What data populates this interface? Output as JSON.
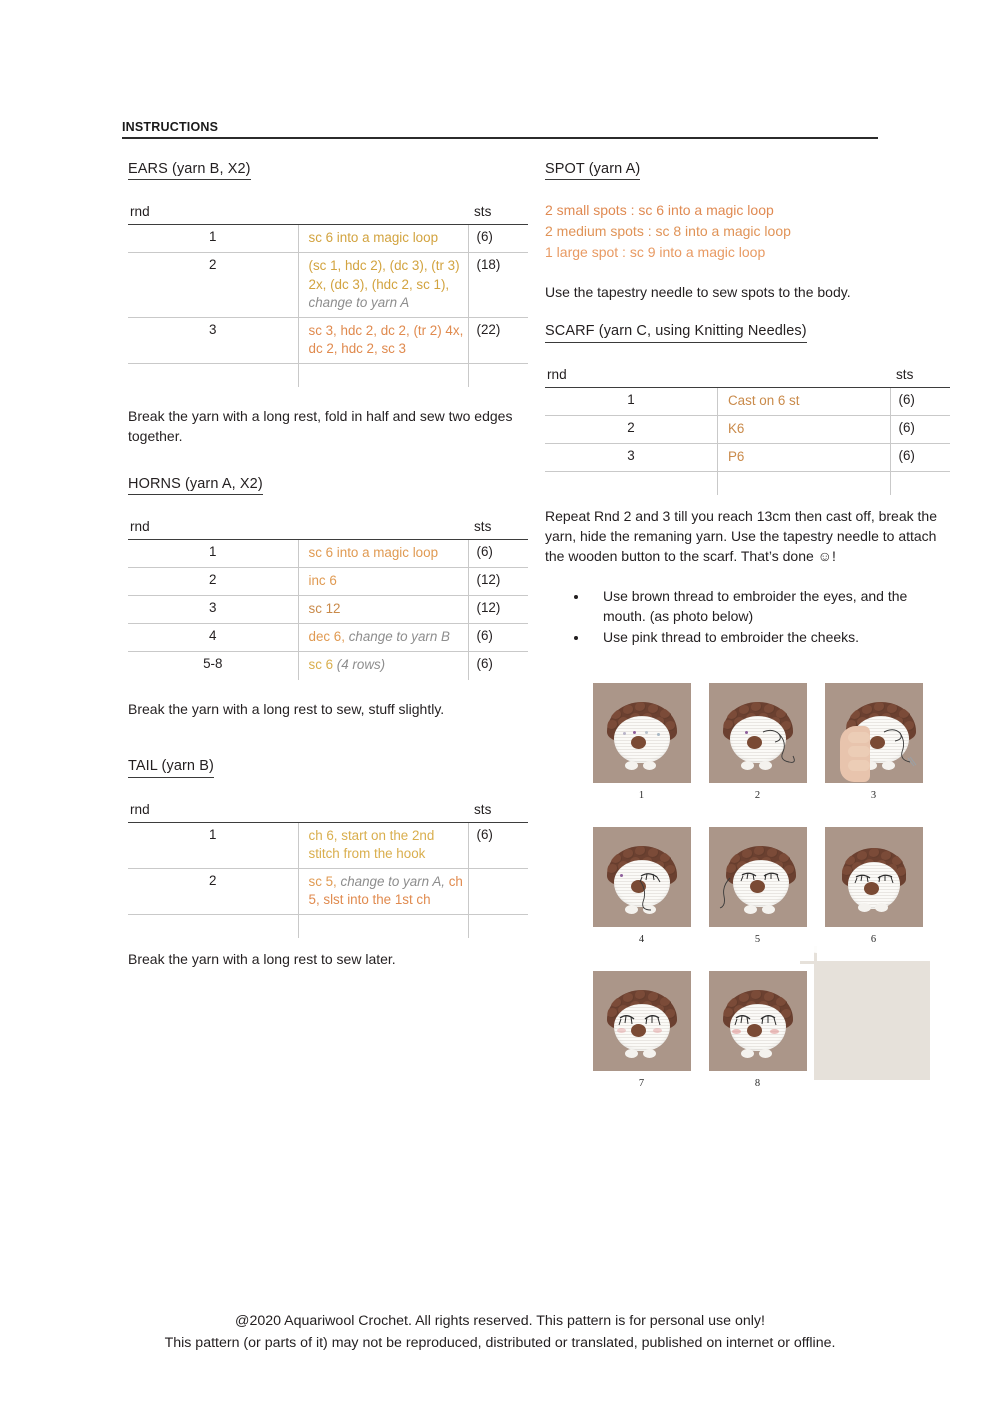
{
  "header": {
    "title": "INSTRUCTIONS"
  },
  "left_column": {
    "ears": {
      "heading": "EARS (yarn B, X2)",
      "columns": {
        "rnd": "rnd",
        "sts": "sts"
      },
      "rows": [
        {
          "rnd": "1",
          "body": "sc 6 into a magic loop",
          "sts": "(6)"
        },
        {
          "rnd": "2",
          "body": "(sc 1, hdc 2), (dc 3), (tr 3) 2x, (dc 3), (hdc 2, sc 1),",
          "note": " change to yarn A",
          "sts": "(18)"
        },
        {
          "rnd": "3",
          "body": "sc 3, hdc 2, dc 2, (tr 2) 4x, dc 2, hdc 2, sc 3",
          "sts": "(22)"
        }
      ],
      "after_text": "Break the yarn with a long rest, fold in half and sew two edges together."
    },
    "horns": {
      "heading": "HORNS (yarn A, X2)",
      "columns": {
        "rnd": "rnd",
        "sts": "sts"
      },
      "rows": [
        {
          "rnd": "1",
          "body": "sc 6 into a magic loop",
          "sts": "(6)"
        },
        {
          "rnd": "2",
          "body": "inc 6",
          "sts": "(12)"
        },
        {
          "rnd": "3",
          "body": "sc 12",
          "sts": "(12)"
        },
        {
          "rnd": "4",
          "body": "dec 6,",
          "note": " change to yarn B",
          "sts": "(6)"
        },
        {
          "rnd": "5-8",
          "body": "sc 6",
          "note": " (4 rows)",
          "sts": "(6)"
        }
      ],
      "after_text": "Break the yarn with a long rest to sew, stuff slightly."
    },
    "tail": {
      "heading": "TAIL (yarn B)",
      "columns": {
        "rnd": "rnd",
        "sts": "sts"
      },
      "rows": [
        {
          "rnd": "1",
          "body": "ch 6, start on the 2nd stitch from the hook",
          "sts": "(6)"
        },
        {
          "rnd": "2",
          "body": "sc 5,",
          "note": " change to yarn A,",
          "body2": " ch 5, slst into the 1st ch",
          "sts": ""
        }
      ],
      "after_text": "Break the yarn with a long rest to sew later."
    }
  },
  "right_column": {
    "spot": {
      "heading": "SPOT (yarn A)",
      "lines": [
        "2 small spots : sc 6 into a magic loop",
        "2 medium spots : sc 8 into a magic loop",
        "1 large spot : sc 9 into a magic loop"
      ],
      "after_text": "Use the tapestry needle to sew spots to the body."
    },
    "scarf": {
      "heading": "SCARF (yarn C, using Knitting Needles)",
      "columns": {
        "rnd": "rnd",
        "sts": "sts"
      },
      "rows": [
        {
          "rnd": "1",
          "body": "Cast on 6 st",
          "sts": "(6)"
        },
        {
          "rnd": "2",
          "body": "K6",
          "sts": "(6)"
        },
        {
          "rnd": "3",
          "body": "P6",
          "sts": "(6)"
        }
      ],
      "after_text": "Repeat Rnd 2 and 3 till you reach 13cm then cast off, break the yarn, hide the remaning yarn. Use the tapestry needle to attach the wooden button to the scarf. That’s done ☺!",
      "bullets": [
        "Use brown thread to embroider the eyes, and the mouth. (as photo below)",
        "Use pink thread to embroider the cheeks."
      ]
    },
    "photos": {
      "captions": [
        "1",
        "2",
        "3",
        "4",
        "5",
        "6",
        "7",
        "8"
      ]
    }
  },
  "footer": {
    "line1": "@2020 Aquariwool Crochet. All rights reserved. This pattern is for personal use only!",
    "line2": "This pattern (or parts of it) may not be reproduced, distributed or translated, published on internet or offline."
  },
  "colors": {
    "gold": "#d2a33f",
    "orange": "#d9813f",
    "light_orange": "#e09a52",
    "note_gray": "#8d8d8d",
    "text": "#231f20",
    "photo_bg": "#ab9689",
    "spine_brown": "#6b4030"
  }
}
